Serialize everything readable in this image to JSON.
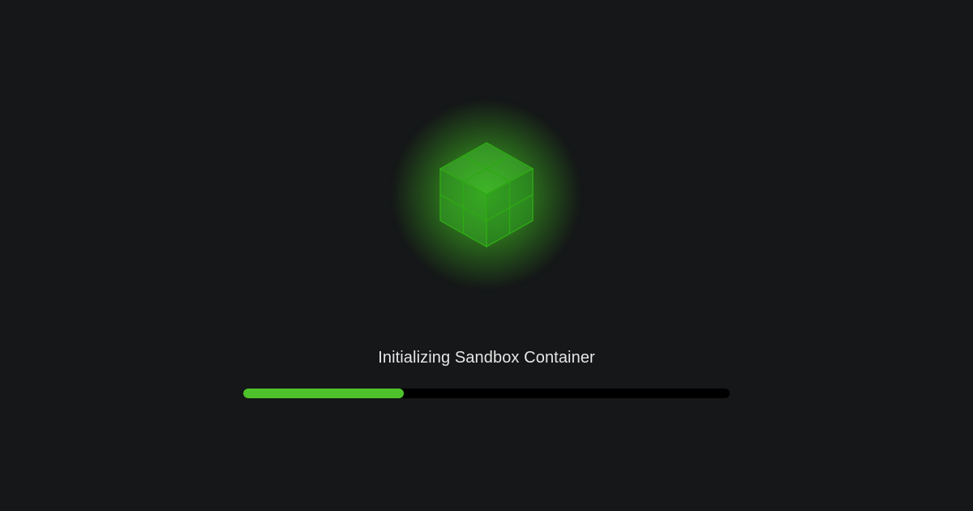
{
  "status_text": "Initializing Sandbox Container",
  "progress_percent": 33,
  "colors": {
    "accent": "#4ec22a",
    "background": "#151718",
    "track": "#000000",
    "text": "#e6e6e6"
  },
  "icon": "cube-wireframe-icon"
}
